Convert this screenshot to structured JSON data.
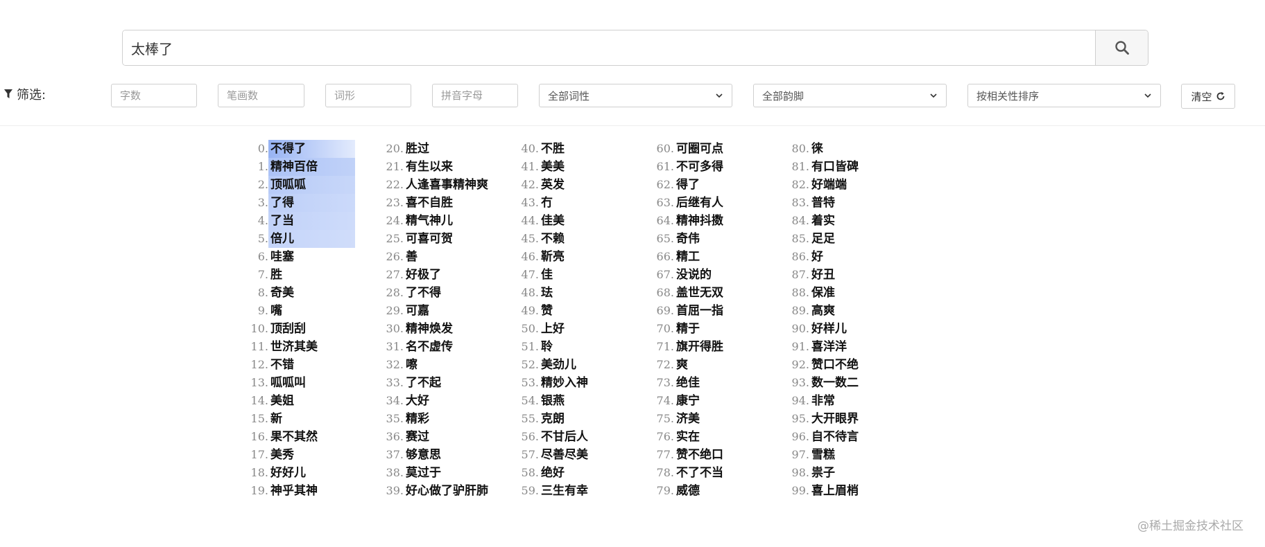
{
  "search": {
    "value": "太棒了",
    "icon": "search-icon"
  },
  "filter": {
    "label": "筛选:",
    "char_count_placeholder": "字数",
    "stroke_count_placeholder": "笔画数",
    "word_form_placeholder": "词形",
    "pinyin_placeholder": "拼音字母",
    "pos_select": "全部词性",
    "rhyme_select": "全部韵脚",
    "sort_select": "按相关性排序",
    "clear_label": "清空"
  },
  "results": [
    [
      "不得了",
      "精神百倍",
      "顶呱呱",
      "了得",
      "了当",
      "倍儿",
      "哇塞",
      "胜",
      "奇美",
      "嘴",
      "顶刮刮",
      "世济其美",
      "不错",
      "呱呱叫",
      "美姐",
      "新",
      "果不其然",
      "美秀",
      "好好儿",
      "神乎其神"
    ],
    [
      "胜过",
      "有生以来",
      "人逢喜事精神爽",
      "喜不自胜",
      "精气神儿",
      "可喜可贺",
      "善",
      "好极了",
      "了不得",
      "可嘉",
      "精神焕发",
      "名不虚传",
      "嚓",
      "了不起",
      "大好",
      "精彩",
      "赛过",
      "够意思",
      "莫过于",
      "好心做了驴肝肺"
    ],
    [
      "不胜",
      "美美",
      "英发",
      "冇",
      "佳美",
      "不赖",
      "靳亮",
      "佳",
      "珐",
      "赞",
      "上好",
      "聆",
      "美劲儿",
      "精妙入神",
      "银燕",
      "克朗",
      "不甘后人",
      "尽善尽美",
      "绝好",
      "三生有幸"
    ],
    [
      "可圈可点",
      "不可多得",
      "得了",
      "后继有人",
      "精神抖擞",
      "奇伟",
      "精工",
      "没说的",
      "盖世无双",
      "首屈一指",
      "精于",
      "旗开得胜",
      "爽",
      "绝佳",
      "康宁",
      "济美",
      "实在",
      "赞不绝口",
      "不了不当",
      "威德"
    ],
    [
      "徕",
      "有口皆碑",
      "好端端",
      "普特",
      "着实",
      "足足",
      "好",
      "好丑",
      "保准",
      "高爽",
      "好样儿",
      "喜洋洋",
      "赞口不绝",
      "数一数二",
      "非常",
      "大开眼界",
      "自不待言",
      "雪糕",
      "祟子",
      "喜上眉梢"
    ]
  ],
  "highlight": [
    1.0,
    0.9,
    0.72,
    0.62,
    0.56,
    0.5
  ],
  "colors": {
    "highlight_strong": "#97b3f3",
    "highlight_light": "#e3ebfd"
  },
  "watermark": "@稀土掘金技术社区"
}
